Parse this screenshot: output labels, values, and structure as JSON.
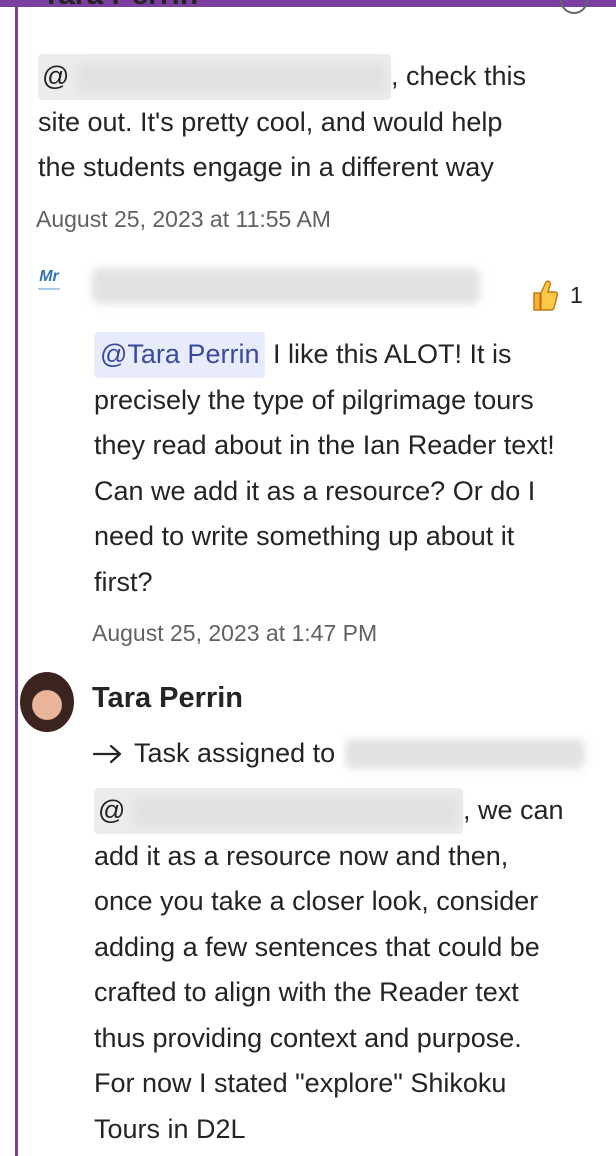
{
  "frame_color": "#7b3fa0",
  "mention_color": "#3a4a9e",
  "top_clipped_name": "Tara Perrin",
  "message1": {
    "at_symbol": "@",
    "after_mention": ", check this",
    "line2": "site out. It's pretty cool, and would help",
    "line3": "the students engage in a different way",
    "timestamp": "August 25, 2023 at 11:55 AM"
  },
  "message2": {
    "avatar_icon": "school-logo-icon",
    "reaction_icon": "thumbs-up-icon",
    "reaction_count": "1",
    "mention": "@Tara Perrin",
    "line1_rest": " I like this ALOT! It is",
    "line2": "precisely the type of pilgrimage tours",
    "line3": "they read about in the Ian Reader text!",
    "line4": "Can we add it as a resource? Or do I",
    "line5": "need to write something up about it",
    "line6": "first?",
    "timestamp": "August 25, 2023 at 1:47 PM"
  },
  "message3": {
    "author": "Tara Perrin",
    "task_icon": "arrow-right-icon",
    "task_label": "Task assigned to",
    "at_symbol": "@",
    "after_mention": ", we can",
    "line2": "add it as a resource now and then,",
    "line3": "once you take a closer look, consider",
    "line4": "adding a few sentences that could be",
    "line5": "crafted to align with the Reader text",
    "line6": "thus providing context and purpose.",
    "line7": "For now I stated \"explore\" Shikoku",
    "line8": "Tours in D2L"
  }
}
